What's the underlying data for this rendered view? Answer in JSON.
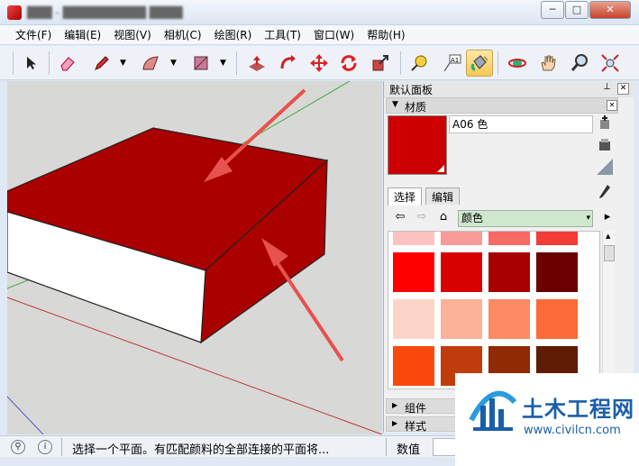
{
  "window": {
    "title_blurred": "███ - ██████████ ████",
    "buttons": {
      "minimize": "─",
      "maximize": "□",
      "close": "✕"
    }
  },
  "menu": [
    "文件(F)",
    "编辑(E)",
    "视图(V)",
    "相机(C)",
    "绘图(R)",
    "工具(T)",
    "窗口(W)",
    "帮助(H)"
  ],
  "toolbar": {
    "tools": [
      {
        "name": "select-tool-icon",
        "glyph": "➤"
      },
      {
        "name": "eraser-tool-icon",
        "glyph": "▰"
      },
      {
        "name": "pencil-tool-icon",
        "glyph": "✎"
      },
      {
        "name": "arc-tool-icon",
        "glyph": "◠"
      },
      {
        "name": "shape-tool-icon",
        "glyph": "◩"
      },
      {
        "name": "push-pull-tool-icon",
        "glyph": "⬆"
      },
      {
        "name": "follow-me-tool-icon",
        "glyph": "↷"
      },
      {
        "name": "move-tool-icon",
        "glyph": "✥"
      },
      {
        "name": "rotate-tool-icon",
        "glyph": "⟳"
      },
      {
        "name": "scale-tool-icon",
        "glyph": "⤢"
      },
      {
        "name": "tape-measure-tool-icon",
        "glyph": "📏"
      },
      {
        "name": "text-tool-icon",
        "glyph": "A1"
      },
      {
        "name": "paint-bucket-tool-icon",
        "glyph": "🪣"
      },
      {
        "name": "orbit-tool-icon",
        "glyph": "◎"
      },
      {
        "name": "pan-tool-icon",
        "glyph": "✋"
      },
      {
        "name": "zoom-tool-icon",
        "glyph": "🔍"
      },
      {
        "name": "zoom-extents-tool-icon",
        "glyph": "⤧"
      }
    ]
  },
  "panel": {
    "title": "默认面板",
    "pin": "⊥",
    "close": "✕",
    "materials": {
      "header": "材质",
      "arrow": "▼",
      "section_close": "✕",
      "material_name": "A06 色",
      "current_color": "#cc0000",
      "tabs": [
        "选择",
        "编辑"
      ],
      "library": "颜色",
      "library_dropdown": "▾",
      "nav": {
        "back": "⇦",
        "forward": "⇨",
        "home": "⌂",
        "details": "▸"
      },
      "swatches": [
        [
          "#fbc3c0",
          "#f99b97",
          "#f86a65",
          "#f33c36"
        ],
        [
          "#ff0000",
          "#d80000",
          "#a80000",
          "#6b0000"
        ],
        [
          "#fdd5c8",
          "#fcb199",
          "#fc8a62",
          "#fb6a37"
        ],
        [
          "#fa4a0b",
          "#c13c0c",
          "#8f2a05",
          "#5f1b03"
        ]
      ]
    },
    "collapsed_sections": [
      {
        "arrow": "▶",
        "label": "组件"
      },
      {
        "arrow": "▶",
        "label": "样式"
      }
    ]
  },
  "status": {
    "message": "选择一个平面。有匹配颜料的全部连接的平面将...",
    "vcb_label": "数值",
    "vcb_value": "",
    "geo_icon": "⚲",
    "info_icon": "i"
  },
  "watermark": {
    "name": "土木工程网",
    "url": "www.civilcn.com"
  }
}
